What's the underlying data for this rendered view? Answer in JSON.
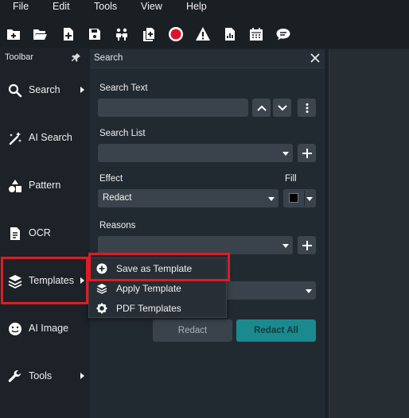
{
  "menubar": {
    "items": [
      "File",
      "Edit",
      "Tools",
      "View",
      "Help"
    ]
  },
  "toolbar_icons": [
    "new-folder-plus-icon",
    "open-folder-icon",
    "new-file-icon",
    "save-icon",
    "group-icon",
    "copy-add-icon",
    "record-icon",
    "warning-icon",
    "report-icon",
    "calendar-icon",
    "comment-icon"
  ],
  "sidebar": {
    "title": "Toolbar",
    "items": [
      {
        "label": "Search",
        "icon": "search-icon",
        "submenu": true
      },
      {
        "label": "AI Search",
        "icon": "magic-wand-icon",
        "submenu": false
      },
      {
        "label": "Pattern",
        "icon": "shapes-icon",
        "submenu": false
      },
      {
        "label": "OCR",
        "icon": "document-icon",
        "submenu": false
      },
      {
        "label": "Templates",
        "icon": "layers-icon",
        "submenu": true
      },
      {
        "label": "AI Image",
        "icon": "smile-icon",
        "submenu": false
      },
      {
        "label": "Tools",
        "icon": "wrench-icon",
        "submenu": true
      }
    ]
  },
  "search_panel": {
    "title": "Search",
    "search_text_label": "Search Text",
    "search_text_value": "",
    "search_list_label": "Search List",
    "search_list_value": "",
    "effect_label": "Effect",
    "effect_value": "Redact",
    "fill_label": "Fill",
    "fill_color": "#000000",
    "reasons_label": "Reasons",
    "reasons_value": "",
    "redact_button": "Redact",
    "redact_all_button": "Redact All"
  },
  "templates_menu": {
    "items": [
      {
        "label": "Save as Template",
        "icon": "plus-circle-icon"
      },
      {
        "label": "Apply Template",
        "icon": "layers-icon"
      },
      {
        "label": "PDF Templates",
        "icon": "gear-icon"
      }
    ]
  },
  "colors": {
    "highlight": "#e11b22",
    "accent": "#1a8a8f",
    "background": "#1c2227"
  }
}
